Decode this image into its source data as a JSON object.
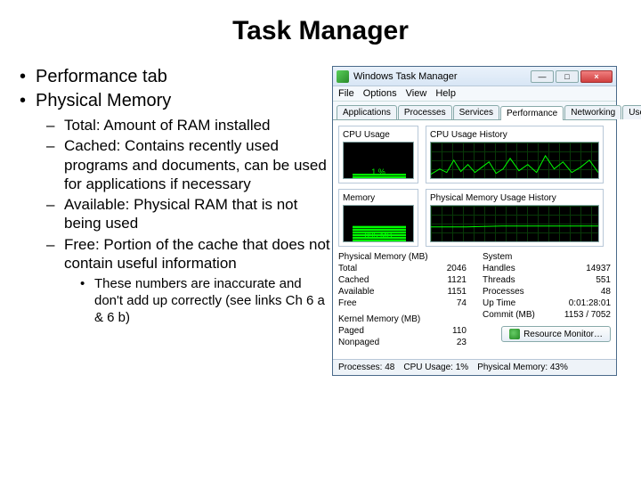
{
  "title": "Task Manager",
  "bullets": {
    "b1": "Performance tab",
    "b2": "Physical Memory",
    "s1": "Total: Amount of RAM installed",
    "s2": "Cached: Contains recently used programs and documents, can be used for applications if necessary",
    "s3": "Available: Physical RAM that is not being used",
    "s4": "Free: Portion of the cache that does not contain useful information",
    "ss1": "These numbers are inaccurate and don't add up correctly (see links Ch 6 a & 6 b)"
  },
  "tm": {
    "windowTitle": "Windows Task Manager",
    "menu": {
      "file": "File",
      "options": "Options",
      "view": "View",
      "help": "Help"
    },
    "tabs": {
      "applications": "Applications",
      "processes": "Processes",
      "services": "Services",
      "performance": "Performance",
      "networking": "Networking",
      "users": "Users"
    },
    "panels": {
      "cpuUsage": "CPU Usage",
      "cpuHist": "CPU Usage History",
      "memory": "Memory",
      "memHist": "Physical Memory Usage History"
    },
    "cpuPct": "1 %",
    "memVal": "895 MB",
    "physmem": {
      "header": "Physical Memory (MB)",
      "totalL": "Total",
      "totalV": "2046",
      "cachedL": "Cached",
      "cachedV": "1121",
      "availL": "Available",
      "availV": "1151",
      "freeL": "Free",
      "freeV": "74"
    },
    "kernmem": {
      "header": "Kernel Memory (MB)",
      "pagedL": "Paged",
      "pagedV": "110",
      "nonpagedL": "Nonpaged",
      "nonpagedV": "23"
    },
    "system": {
      "header": "System",
      "handlesL": "Handles",
      "handlesV": "14937",
      "threadsL": "Threads",
      "threadsV": "551",
      "processesL": "Processes",
      "processesV": "48",
      "uptimeL": "Up Time",
      "uptimeV": "0:01:28:01",
      "commitL": "Commit (MB)",
      "commitV": "1153 / 7052"
    },
    "resmon": "Resource Monitor…",
    "status": {
      "processes": "Processes: 48",
      "cpu": "CPU Usage: 1%",
      "mem": "Physical Memory: 43%"
    }
  }
}
